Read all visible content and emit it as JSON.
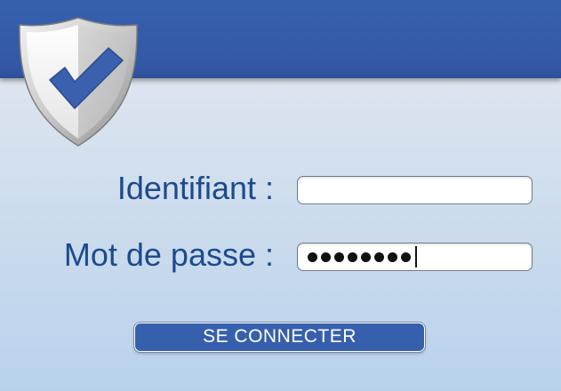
{
  "icon": "shield-check-icon",
  "colors": {
    "header_bar": "#3358a6",
    "label_text": "#1d4a8e",
    "button_bg": "#3660ad",
    "button_text": "#ffffff",
    "checkmark": "#3a60ae"
  },
  "form": {
    "username": {
      "label": "Identifiant :",
      "value": ""
    },
    "password": {
      "label": "Mot de passe :",
      "masked_length": 8
    },
    "submit_label": "SE CONNECTER"
  }
}
